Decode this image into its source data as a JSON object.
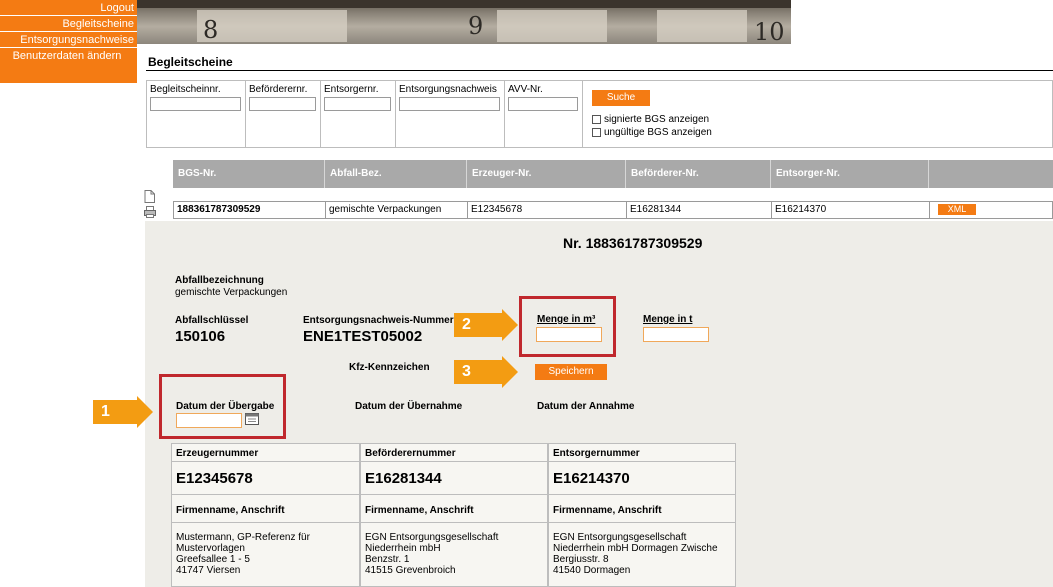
{
  "nav": {
    "items": [
      "Logout",
      "Begleitscheine",
      "Entsorgungsnachweise",
      "Benutzerdaten ändern"
    ]
  },
  "banner": {
    "numbers": [
      "8",
      "9",
      "10"
    ]
  },
  "page": {
    "title": "Begleitscheine"
  },
  "search": {
    "fields": [
      {
        "label": "Begleitscheinnr.",
        "value": ""
      },
      {
        "label": "Beförderernr.",
        "value": ""
      },
      {
        "label": "Entsorgernr.",
        "value": ""
      },
      {
        "label": "Entsorgungsnachweis",
        "value": ""
      },
      {
        "label": "AVV-Nr.",
        "value": ""
      }
    ],
    "button": "Suche",
    "checkboxes": [
      {
        "label": "signierte BGS anzeigen",
        "checked": false
      },
      {
        "label": "ungültige BGS anzeigen",
        "checked": false
      }
    ]
  },
  "table": {
    "headers": [
      "BGS-Nr.",
      "Abfall-Bez.",
      "Erzeuger-Nr.",
      "Beförderer-Nr.",
      "Entsorger-Nr.",
      ""
    ],
    "row": {
      "bgs": "188361787309529",
      "abfall": "gemischte Verpackungen",
      "erzeuger": "E12345678",
      "befoerderer": "E16281344",
      "entsorger": "E16214370",
      "button": "XML"
    }
  },
  "detail": {
    "title": "Nr. 188361787309529",
    "abfallbezeichnung_label": "Abfallbezeichnung",
    "abfallbezeichnung_value": "gemischte Verpackungen",
    "abfallschluessel_label": "Abfallschlüssel",
    "abfallschluessel_value": "150106",
    "nachweis_label": "Entsorgungsnachweis-Nummer",
    "nachweis_value": "ENE1TEST05002",
    "menge_m3_label": "Menge in m³",
    "menge_t_label": "Menge in t",
    "kfz_label": "Kfz-Kennzeichen",
    "save_button": "Speichern",
    "datum_uebergabe_label": "Datum der Übergabe",
    "datum_uebernahme_label": "Datum der Übernahme",
    "datum_annahme_label": "Datum der Annahme"
  },
  "callouts": [
    "1",
    "2",
    "3"
  ],
  "parties": [
    {
      "header": "Erzeugernummer",
      "number": "E12345678",
      "firm_label": "Firmenname, Anschrift",
      "lines": [
        "Mustermann, GP-Referenz für",
        "Mustervorlagen",
        "Greefsallee 1 - 5",
        "41747 Viersen"
      ]
    },
    {
      "header": "Beförderernummer",
      "number": "E16281344",
      "firm_label": "Firmenname, Anschrift",
      "lines": [
        "EGN Entsorgungsgesellschaft",
        "Niederrhein mbH",
        "Benzstr. 1",
        "41515 Grevenbroich"
      ]
    },
    {
      "header": "Entsorgernummer",
      "number": "E16214370",
      "firm_label": "Firmenname, Anschrift",
      "lines": [
        "EGN Entsorgungsgesellschaft",
        "Niederrhein mbH Dormagen Zwische",
        "Bergiusstr. 8",
        "41540 Dormagen"
      ]
    }
  ],
  "colors": {
    "accent": "#f47b13",
    "callout_border": "#c0282d",
    "callout_arrow": "#f39c12",
    "header_gray": "#a9a9a9"
  }
}
